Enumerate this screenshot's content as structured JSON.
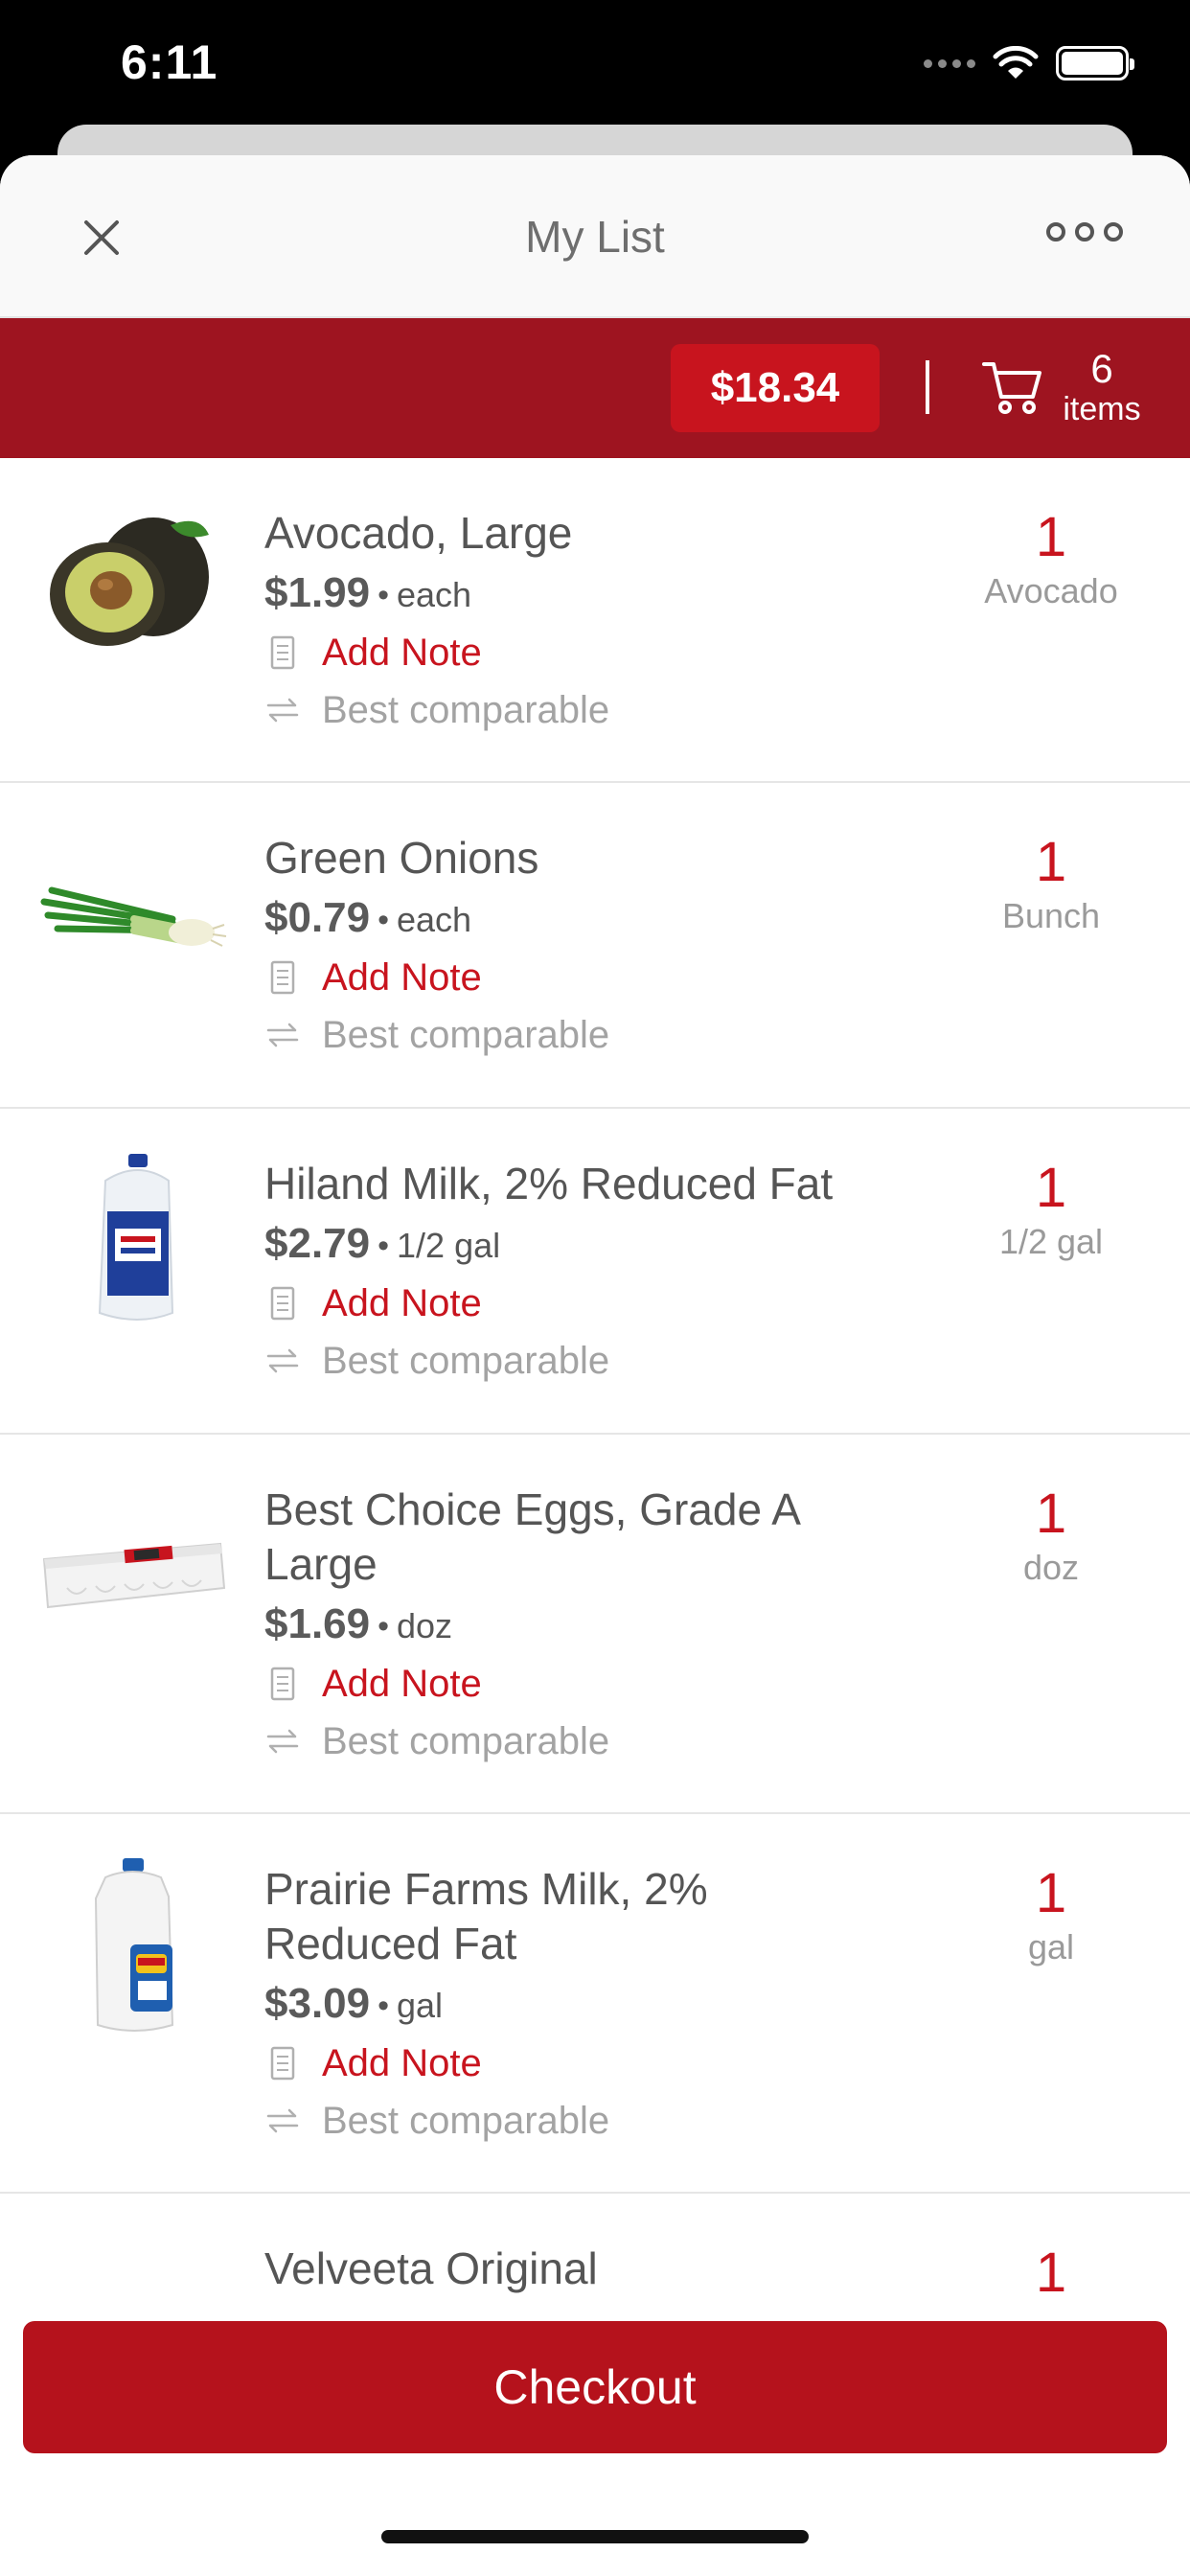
{
  "status_bar": {
    "time": "6:11"
  },
  "nav": {
    "title": "My List"
  },
  "summary": {
    "total": "$18.34",
    "item_count": "6",
    "item_label": "items"
  },
  "items": [
    {
      "name": "Avocado, Large",
      "price": "$1.99",
      "unit": "each",
      "note_label": "Add Note",
      "comparable_label": "Best comparable",
      "qty": "1",
      "qty_unit": "Avocado"
    },
    {
      "name": "Green Onions",
      "price": "$0.79",
      "unit": "each",
      "note_label": "Add Note",
      "comparable_label": "Best comparable",
      "qty": "1",
      "qty_unit": "Bunch"
    },
    {
      "name": "Hiland Milk, 2% Reduced Fat",
      "price": "$2.79",
      "unit": "1/2 gal",
      "note_label": "Add Note",
      "comparable_label": "Best comparable",
      "qty": "1",
      "qty_unit": "1/2 gal"
    },
    {
      "name": "Best Choice Eggs, Grade A Large",
      "price": "$1.69",
      "unit": "doz",
      "note_label": "Add Note",
      "comparable_label": "Best comparable",
      "qty": "1",
      "qty_unit": "doz"
    },
    {
      "name": "Prairie Farms Milk, 2% Reduced Fat",
      "price": "$3.09",
      "unit": "gal",
      "note_label": "Add Note",
      "comparable_label": "Best comparable",
      "qty": "1",
      "qty_unit": "gal"
    },
    {
      "name": "Velveeta Original",
      "qty": "1"
    }
  ],
  "checkout": {
    "label": "Checkout"
  },
  "colors": {
    "brand_red": "#c8141e",
    "bar_red": "#9e1420"
  },
  "icons": [
    "close-icon",
    "more-icon",
    "cart-icon",
    "note-icon",
    "swap-icon"
  ]
}
